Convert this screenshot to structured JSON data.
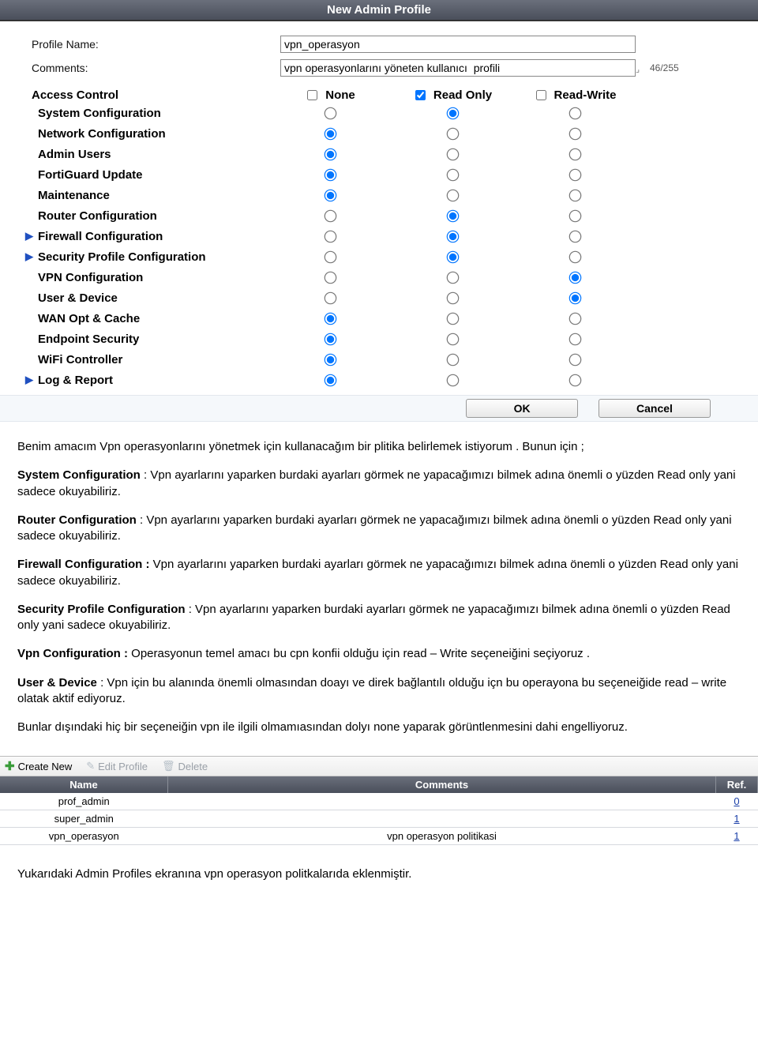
{
  "titlebar": "New Admin Profile",
  "form": {
    "profile_name_label": "Profile Name:",
    "profile_name_value": "vpn_operasyon",
    "comments_label": "Comments:",
    "comments_value": "vpn operasyonlarını yöneten kullanıcı  profili",
    "comments_counter": "46/255"
  },
  "access_control": {
    "label": "Access Control",
    "headers": {
      "none": "None",
      "ro": "Read Only",
      "rw": "Read-Write"
    },
    "header_checks": {
      "none": false,
      "ro": true,
      "rw": false
    },
    "rows": [
      {
        "name": "System Configuration",
        "sel": "ro",
        "expand": false
      },
      {
        "name": "Network Configuration",
        "sel": "none",
        "expand": false
      },
      {
        "name": "Admin Users",
        "sel": "none",
        "expand": false
      },
      {
        "name": "FortiGuard Update",
        "sel": "none",
        "expand": false
      },
      {
        "name": "Maintenance",
        "sel": "none",
        "expand": false
      },
      {
        "name": "Router Configuration",
        "sel": "ro",
        "expand": false
      },
      {
        "name": "Firewall Configuration",
        "sel": "ro",
        "expand": true
      },
      {
        "name": "Security Profile Configuration",
        "sel": "ro",
        "expand": true
      },
      {
        "name": "VPN Configuration",
        "sel": "rw",
        "expand": false
      },
      {
        "name": "User & Device",
        "sel": "rw",
        "expand": false
      },
      {
        "name": "WAN Opt & Cache",
        "sel": "none",
        "expand": false
      },
      {
        "name": "Endpoint Security",
        "sel": "none",
        "expand": false
      },
      {
        "name": "WiFi Controller",
        "sel": "none",
        "expand": false
      },
      {
        "name": "Log & Report",
        "sel": "none",
        "expand": true
      }
    ]
  },
  "buttons": {
    "ok": "OK",
    "cancel": "Cancel"
  },
  "article": {
    "p1": "Benim amacım Vpn operasyonlarını yönetmek için kullanacağım bir  plitika belirlemek istiyorum . Bunun için ;",
    "p2a": "System Configuration",
    "p2b": " :  Vpn  ayarlarını yaparken burdaki ayarları görmek  ne yapacağımızı bilmek adına önemli o yüzden Read only yani sadece okuyabiliriz.",
    "p3a": "Router Configuration",
    "p3b": " : Vpn  ayarlarını yaparken burdaki ayarları görmek  ne yapacağımızı bilmek adına önemli o yüzden Read only yani sadece okuyabiliriz.",
    "p4a": "Firewall Configuration :",
    "p4b": " Vpn  ayarlarını yaparken burdaki ayarları görmek  ne yapacağımızı bilmek adına önemli o yüzden Read only yani sadece okuyabiliriz.",
    "p5a": "Security Profile Configuration ",
    "p5b": " :  Vpn  ayarlarını yaparken burdaki ayarları görmek  ne yapacağımızı bilmek adına önemli o yüzden Read only yani sadece okuyabiliriz.",
    "p6a": "Vpn Configuration :",
    "p6b": " Operasyonun temel amacı bu cpn konfii olduğu için read – Write  seçeneiğini seçiyoruz .",
    "p7a": "User & Device ",
    "p7b": " :  Vpn için bu alanında önemli olmasından doayı ve direk bağlantılı olduğu içn bu operayona   bu seçeneiğide  read – write olatak aktif ediyoruz.",
    "p8": "Bunlar dışındaki hiç bir seçeneiğin vpn ile ilgili olmamıasından dolyı none yaparak  görüntlenmesini dahi engelliyoruz."
  },
  "toolbar": {
    "create": "Create New",
    "edit": "Edit Profile",
    "delete": "Delete"
  },
  "profiles_table": {
    "headers": {
      "name": "Name",
      "comments": "Comments",
      "ref": "Ref."
    },
    "rows": [
      {
        "name": "prof_admin",
        "comments": "",
        "ref": "0"
      },
      {
        "name": "super_admin",
        "comments": "",
        "ref": "1"
      },
      {
        "name": "vpn_operasyon",
        "comments": "vpn operasyon politikasi",
        "ref": "1"
      }
    ]
  },
  "footnote": "Yukarıdaki Admin Profiles ekranına vpn operasyon politkalarıda eklenmiştir."
}
